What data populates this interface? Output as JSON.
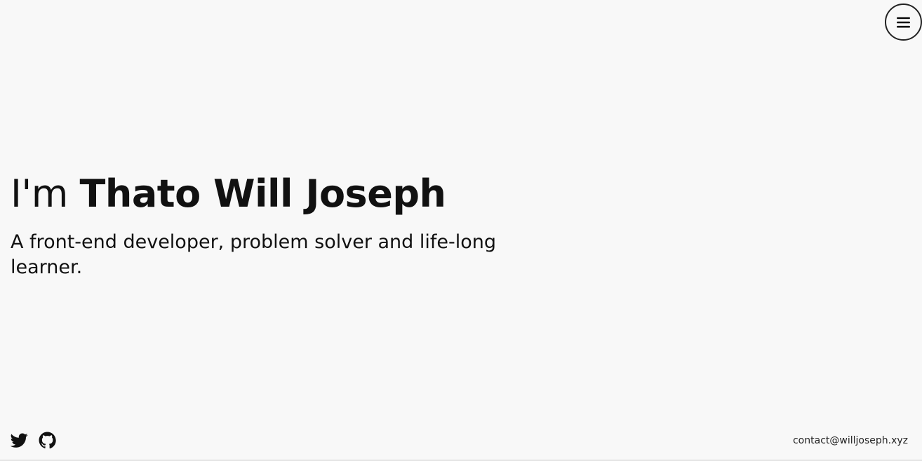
{
  "nav": {
    "menu_icon": "hamburger-menu-icon"
  },
  "hero": {
    "greeting": "I'm ",
    "name": "Thato Will Joseph",
    "tagline": "A front-end developer, problem solver and life-long learner."
  },
  "footer": {
    "social": [
      {
        "icon": "twitter-icon"
      },
      {
        "icon": "github-icon"
      }
    ],
    "email": "contact@willjoseph.xyz"
  }
}
